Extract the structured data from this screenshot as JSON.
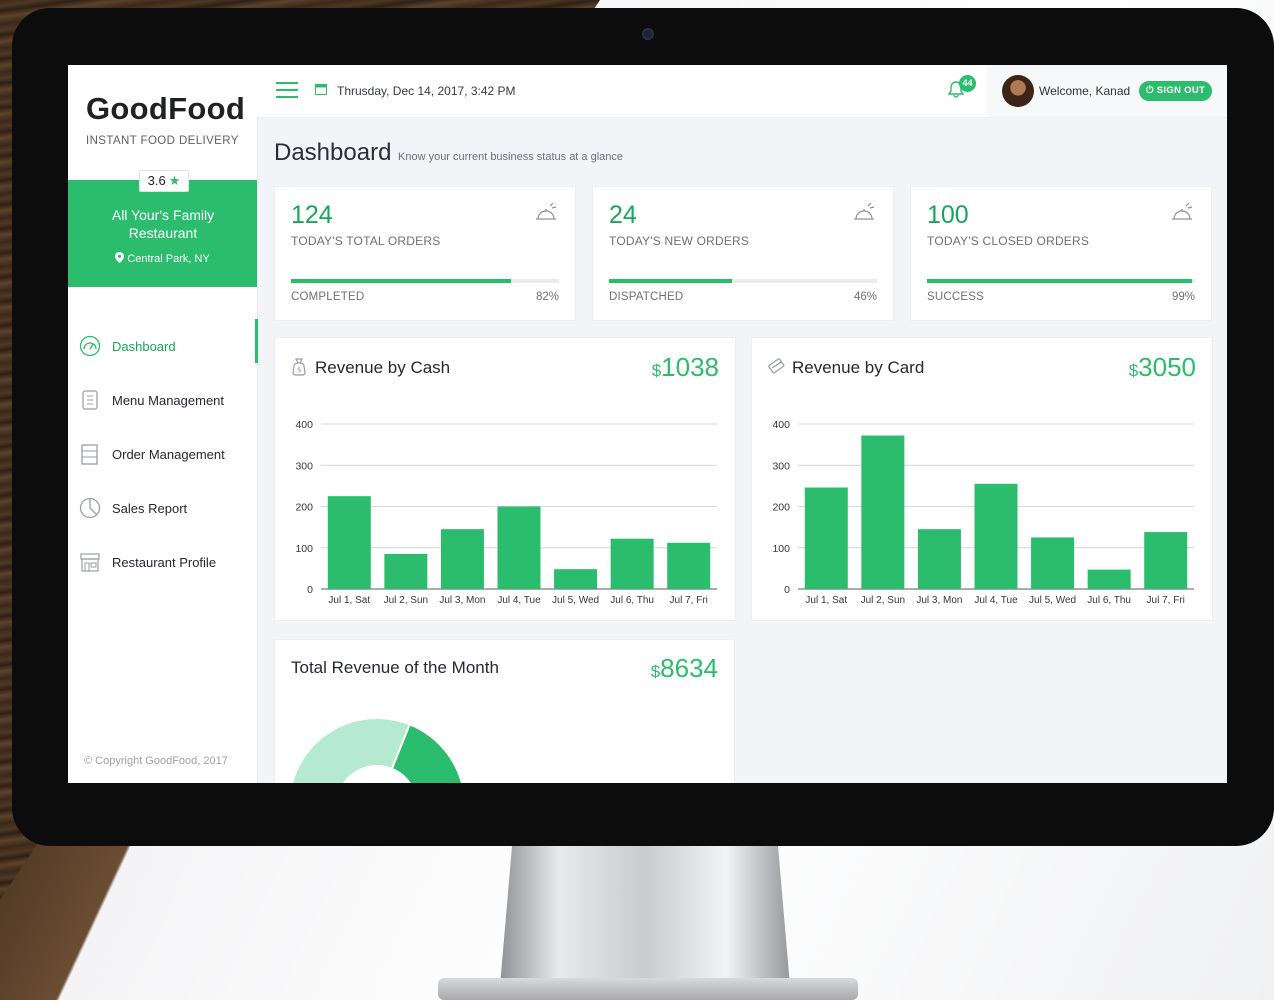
{
  "brand": {
    "name": "GoodFood",
    "tagline": "INSTANT FOOD DELIVERY"
  },
  "restaurant": {
    "rating": "3.6",
    "name": "All Your's Family Restaurant",
    "location": "Central Park, NY"
  },
  "nav": [
    {
      "label": "Dashboard",
      "icon": "gauge-icon",
      "active": true
    },
    {
      "label": "Menu Management",
      "icon": "menu-card-icon",
      "active": false
    },
    {
      "label": "Order Management",
      "icon": "order-list-icon",
      "active": false
    },
    {
      "label": "Sales Report",
      "icon": "pie-chart-icon",
      "active": false
    },
    {
      "label": "Restaurant Profile",
      "icon": "storefront-icon",
      "active": false
    }
  ],
  "copyright": "© Copyright GoodFood, 2017",
  "topbar": {
    "datetime": "Thrusday, Dec 14, 2017, 3:42 PM",
    "notifications": "44",
    "welcome": "Welcome, Kanad",
    "signout": "SIGN OUT"
  },
  "page": {
    "title": "Dashboard",
    "subtitle": "Know your current business status at a glance"
  },
  "stats": [
    {
      "value": "124",
      "label": "TODAY'S TOTAL ORDERS",
      "foot": "COMPLETED",
      "pct_text": "82%",
      "pct": 82
    },
    {
      "value": "24",
      "label": "TODAY'S NEW ORDERS",
      "foot": "DISPATCHED",
      "pct_text": "46%",
      "pct": 46
    },
    {
      "value": "100",
      "label": "TODAY'S CLOSED ORDERS",
      "foot": "SUCCESS",
      "pct_text": "99%",
      "pct": 99
    }
  ],
  "revenue_cash": {
    "title": "Revenue by Cash",
    "currency": "$",
    "amount": "1038"
  },
  "revenue_card": {
    "title": "Revenue by Card",
    "currency": "$",
    "amount": "3050"
  },
  "total": {
    "title": "Total Revenue of the Month",
    "currency": "$",
    "amount": "8634",
    "donut": [
      28,
      72
    ]
  },
  "colors": {
    "accent": "#2cbc6e",
    "donut_light": "#b6ead0"
  },
  "chart_data": [
    {
      "type": "bar",
      "categories": [
        "Jul 1, Sat",
        "Jul 2, Sun",
        "Jul 3, Mon",
        "Jul 4, Tue",
        "Jul 5, Wed",
        "Jul 6, Thu",
        "Jul 7, Fri"
      ],
      "values": [
        225,
        85,
        145,
        200,
        48,
        122,
        112
      ],
      "yticks": [
        "0",
        "100",
        "200",
        "300",
        "400"
      ],
      "ylim": [
        0,
        400
      ]
    },
    {
      "type": "bar",
      "categories": [
        "Jul 1, Sat",
        "Jul 2, Sun",
        "Jul 3, Mon",
        "Jul 4, Tue",
        "Jul 5, Wed",
        "Jul 6, Thu",
        "Jul 7, Fri"
      ],
      "values": [
        246,
        372,
        145,
        255,
        125,
        47,
        138
      ],
      "yticks": [
        "0",
        "100",
        "200",
        "300",
        "400"
      ],
      "ylim": [
        0,
        400
      ]
    }
  ]
}
